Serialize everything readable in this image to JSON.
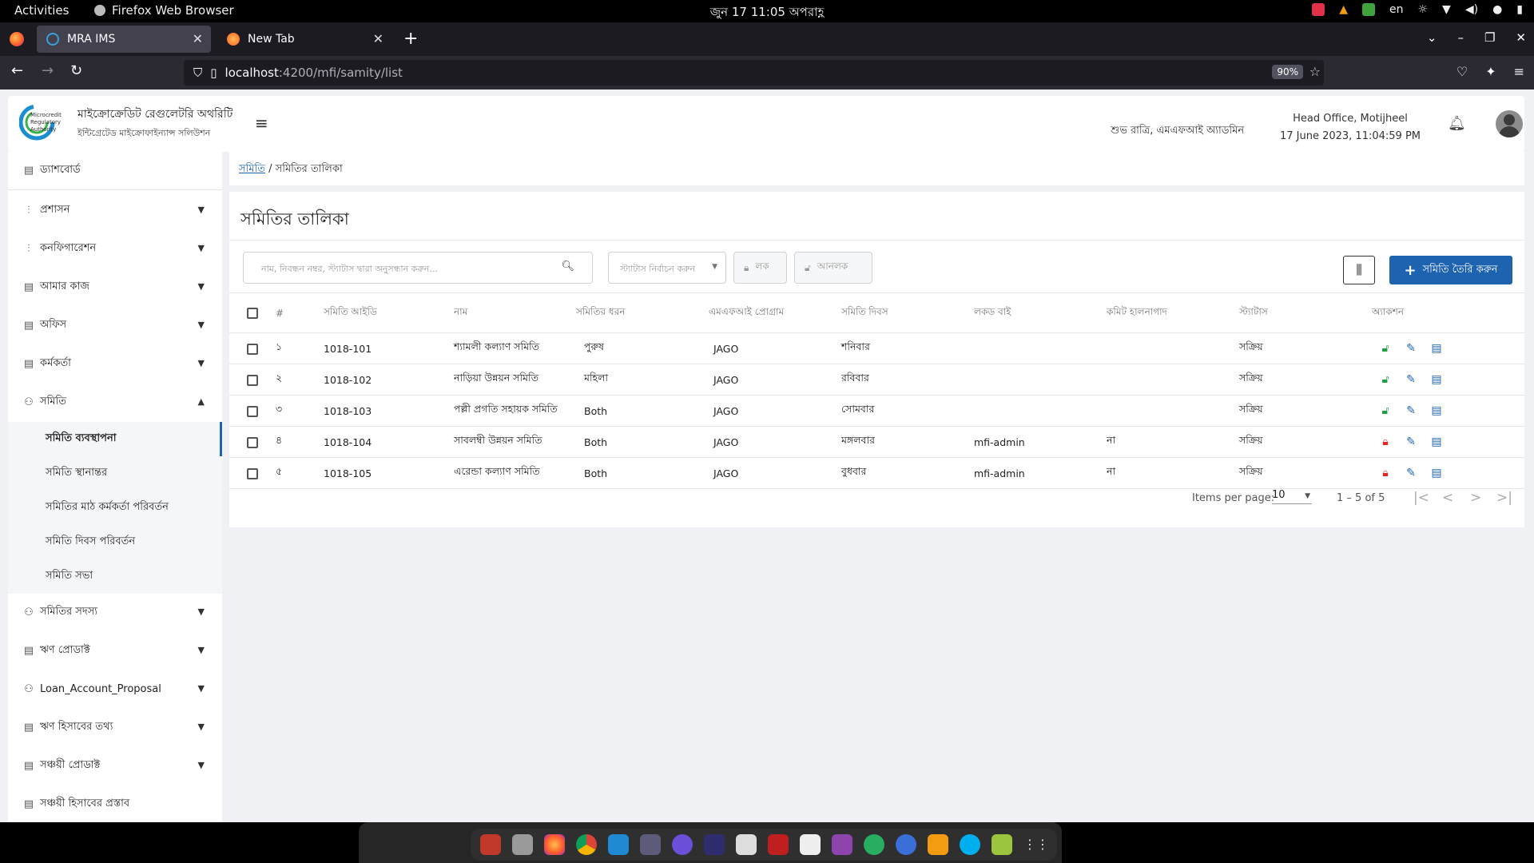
{
  "system_bar": {
    "activities": "Activities",
    "app_name": "Firefox Web Browser",
    "clock": "জুন 17  11:05 অপরাহ্ণ",
    "lang": "en"
  },
  "browser": {
    "tabs": [
      {
        "label": "MRA IMS"
      },
      {
        "label": "New Tab"
      }
    ],
    "url_host": "localhost",
    "url_path": ":4200/mfi/samity/list",
    "zoom": "90%"
  },
  "header": {
    "org_name": "মাইক্রোক্রেডিট রেগুলেটরি অথরিটি",
    "org_sub": "ইন্টিগ্রেটেড মাইক্রোফাইন্যান্স সলিউশন",
    "logo_line1": "Microcredit",
    "logo_line2": "Regulatory",
    "logo_line3": "Authority",
    "greeting": "শুভ রাত্রি, এমএফআই অ্যাডমিন",
    "office": "Head Office, Motijheel",
    "datetime": "17 June 2023, 11:04:59 PM"
  },
  "sidebar": {
    "dashboard": "ড্যাশবোর্ড",
    "items": [
      {
        "label": "প্রশাসন",
        "icon": "sliders-icon"
      },
      {
        "label": "কনফিগারেশন",
        "icon": "sliders-icon"
      },
      {
        "label": "আমার কাজ",
        "icon": "document-icon"
      },
      {
        "label": "অফিস",
        "icon": "document-icon"
      },
      {
        "label": "কর্মকর্তা",
        "icon": "document-icon"
      },
      {
        "label": "সমিতি",
        "icon": "group-icon"
      }
    ],
    "samity_sub": [
      {
        "label": "সমিতি ব্যবস্থাপনা",
        "active": true
      },
      {
        "label": "সমিতি স্থানান্তর"
      },
      {
        "label": "সমিতির মাঠ কর্মকর্তা পরিবর্তন"
      },
      {
        "label": "সমিতি দিবস পরিবর্তন"
      },
      {
        "label": "সমিতি সভা"
      }
    ],
    "items_after": [
      {
        "label": "সমিতির সদস্য",
        "icon": "group-icon"
      },
      {
        "label": "ঋণ প্রোডাক্ট",
        "icon": "document-icon"
      },
      {
        "label": "Loan_Account_Proposal",
        "icon": "group-icon"
      },
      {
        "label": "ঋণ হিসাবের তথ্য",
        "icon": "document-icon"
      },
      {
        "label": "সঞ্চয়ী প্রোডাক্ট",
        "icon": "document-icon"
      },
      {
        "label": "সঞ্চয়ী হিসাবের প্রস্তাব",
        "icon": "document-icon"
      }
    ]
  },
  "breadcrumb": {
    "parent": "সমিতি",
    "sep": " / ",
    "current": "সমিতির তালিকা"
  },
  "main": {
    "title": "সমিতির তালিকা",
    "search_placeholder": "নাম, নিবন্ধন নম্বর, স্ট্যাটাস দ্বারা অনুসন্ধান করুন...",
    "status_placeholder": "স্ট্যাটাস নির্বাচন করুন",
    "lock_label": "লক",
    "unlock_label": "আনলক",
    "create_label": "সমিতি তৈরি করুন"
  },
  "table": {
    "headers": [
      "#",
      "সমিতি আইডি",
      "নাম",
      "সমিতির ধরন",
      "এমএফআই প্রোগ্রাম",
      "সমিতি দিবস",
      "লকড বাই",
      "কমিট হালনাগাদ",
      "স্ট্যাটাস",
      "অ্যাকশন"
    ],
    "rows": [
      {
        "no": "১",
        "id": "1018-101",
        "name": "শ্যামলী কল্যাণ সমিতি",
        "type": "পুরুষ",
        "program": "JAGO",
        "day": "শনিবার",
        "locked_by": "",
        "commit": "",
        "status": "সক্রিয়",
        "locked": false
      },
      {
        "no": "২",
        "id": "1018-102",
        "name": "নাড়িয়া উন্নয়ন সমিতি",
        "type": "মহিলা",
        "program": "JAGO",
        "day": "রবিবার",
        "locked_by": "",
        "commit": "",
        "status": "সক্রিয়",
        "locked": false
      },
      {
        "no": "৩",
        "id": "1018-103",
        "name": "পল্লী প্রগতি সহায়ক সমিতি",
        "type": "Both",
        "program": "JAGO",
        "day": "সোমবার",
        "locked_by": "",
        "commit": "",
        "status": "সক্রিয়",
        "locked": false
      },
      {
        "no": "৪",
        "id": "1018-104",
        "name": "সাবলম্বী উন্নয়ন সমিতি",
        "type": "Both",
        "program": "JAGO",
        "day": "মঙ্গলবার",
        "locked_by": "mfi-admin",
        "commit": "না",
        "status": "সক্রিয়",
        "locked": true
      },
      {
        "no": "৫",
        "id": "1018-105",
        "name": "এরেন্ডা কল্যাণ সমিতি",
        "type": "Both",
        "program": "JAGO",
        "day": "বুধবার",
        "locked_by": "mfi-admin",
        "commit": "না",
        "status": "সক্রিয়",
        "locked": true
      }
    ]
  },
  "paginator": {
    "items_per_page_label": "Items per page:",
    "page_size": "10",
    "range": "1 – 5 of 5"
  },
  "colors": {
    "accent": "#1e63b0",
    "unlock": "#1e9e44",
    "lock": "#e02727"
  }
}
